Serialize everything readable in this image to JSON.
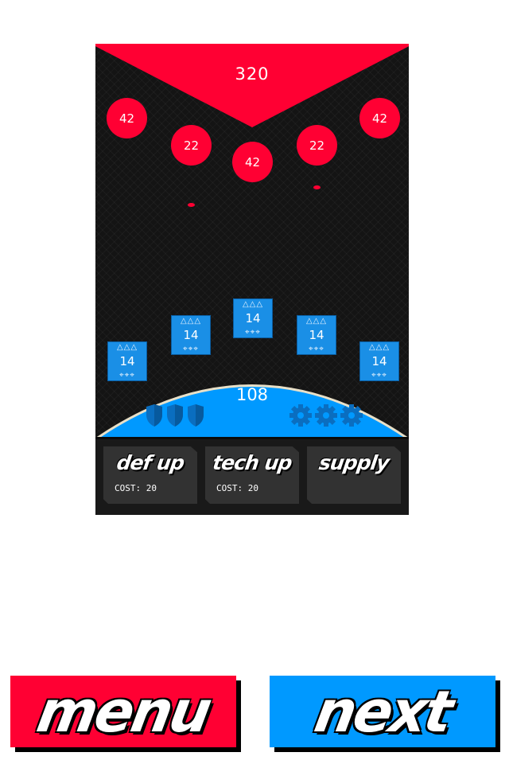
{
  "enemy": {
    "base_hp": "320",
    "units": [
      "42",
      "22",
      "42",
      "22",
      "42"
    ]
  },
  "player": {
    "base_hp": "108",
    "units": [
      {
        "hp": "14",
        "top_icons": "△△△",
        "bottom_icons": "⌖⌖⌖"
      },
      {
        "hp": "14",
        "top_icons": "△△△",
        "bottom_icons": "⌖⌖⌖"
      },
      {
        "hp": "14",
        "top_icons": "△△△",
        "bottom_icons": "⌖⌖⌖"
      },
      {
        "hp": "14",
        "top_icons": "△△△",
        "bottom_icons": "⌖⌖⌖"
      },
      {
        "hp": "14",
        "top_icons": "△△△",
        "bottom_icons": "⌖⌖⌖"
      }
    ],
    "shields": 3,
    "gears": 3
  },
  "commands": [
    {
      "label": "def up",
      "cost": "COST: 20"
    },
    {
      "label": "tech up",
      "cost": "COST: 20"
    },
    {
      "label": "supply",
      "cost": ""
    }
  ],
  "buttons": {
    "menu": "menu",
    "next": "next"
  },
  "colors": {
    "enemy": "#ff0033",
    "player": "#0099ff",
    "board": "#141414",
    "panel": "#323232"
  },
  "icons": {
    "shield": "shield-icon",
    "gear": "gear-icon",
    "triangle": "triangle-icon",
    "target": "crosshair-icon"
  }
}
